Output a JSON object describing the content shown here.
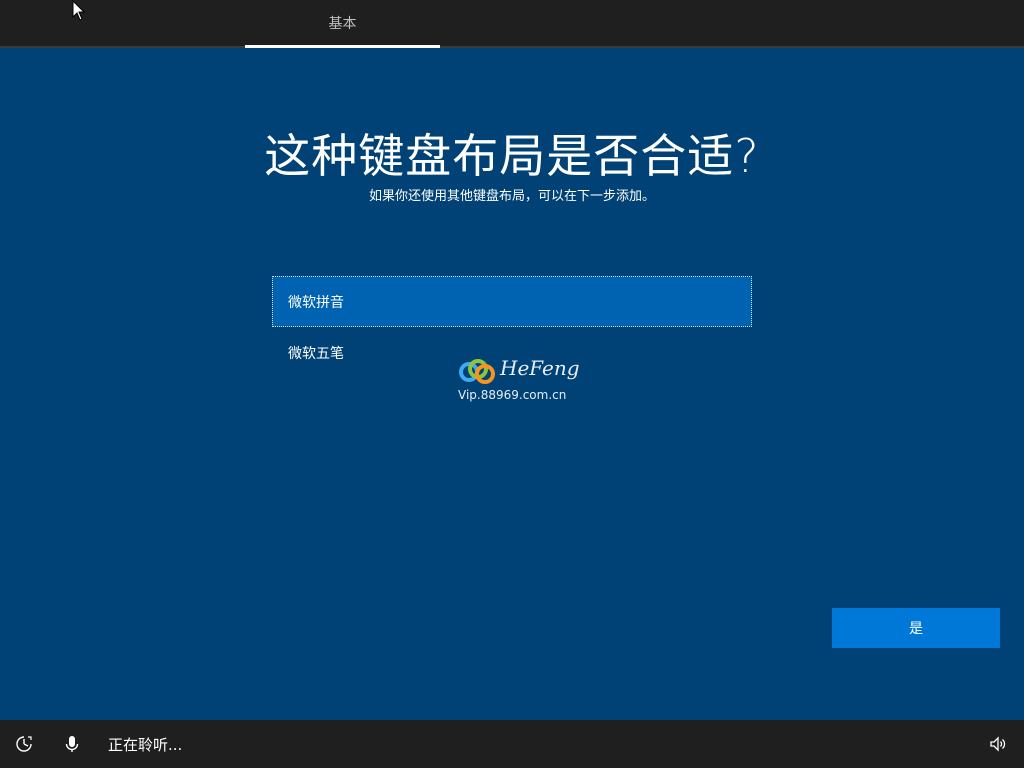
{
  "header": {
    "tab_label": "基本"
  },
  "main": {
    "title": "这种键盘布局是否合适?",
    "subtitle": "如果你还使用其他键盘布局，可以在下一步添加。",
    "options": [
      {
        "label": "微软拼音",
        "selected": true
      },
      {
        "label": "微软五笔",
        "selected": false
      }
    ],
    "watermark": {
      "brand": "HeFeng",
      "url": "Vip.88969.com.cn"
    },
    "yes_label": "是"
  },
  "footer": {
    "status_text": "正在聆听..."
  },
  "icons": {
    "ease_of_access": "ease-of-access-icon",
    "microphone": "microphone-icon",
    "volume": "volume-icon"
  },
  "colors": {
    "background": "#004275",
    "selected_option": "#0063b1",
    "primary_button": "#0078d7",
    "bars": "#1f1f1f"
  }
}
